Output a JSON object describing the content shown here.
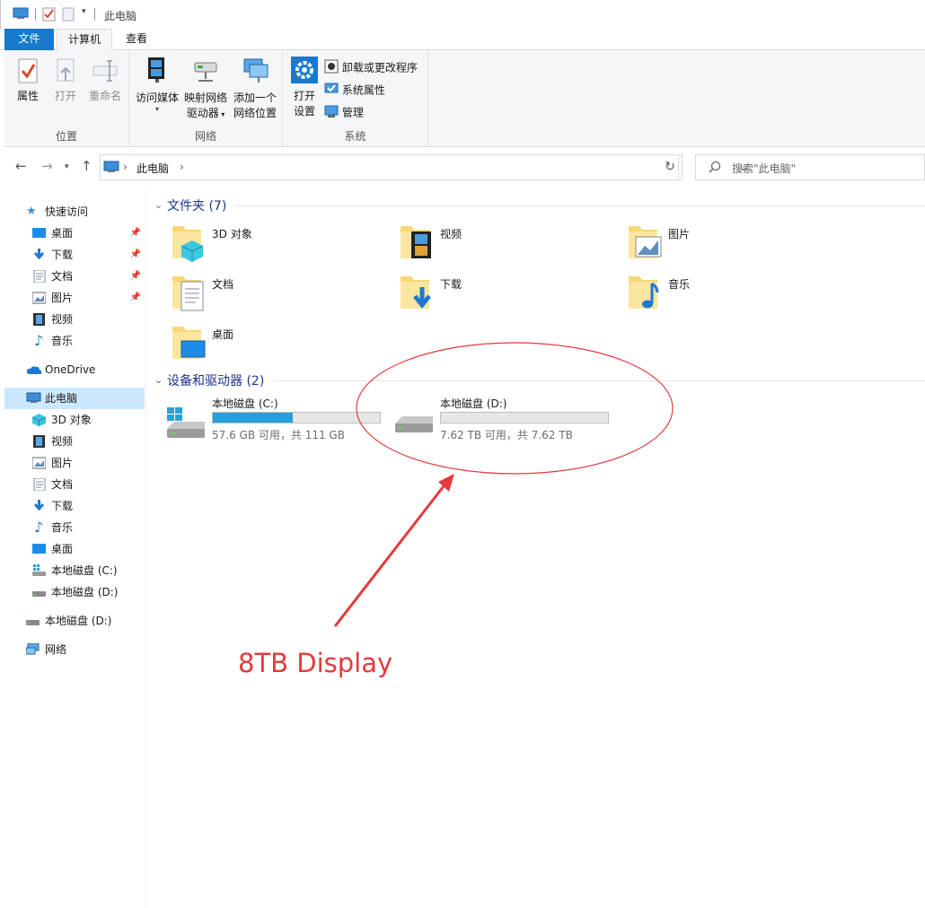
{
  "titlebar": {
    "title": "此电脑"
  },
  "tabs": {
    "file": "文件",
    "computer": "计算机",
    "view": "查看"
  },
  "ribbon": {
    "location": {
      "label": "位置",
      "properties": "属性",
      "open": "打开",
      "rename": "重命名"
    },
    "network": {
      "label": "网络",
      "media_line1": "访问媒体",
      "map_line1": "映射网络",
      "map_line2": "驱动器",
      "add_line1": "添加一个",
      "add_line2": "网络位置"
    },
    "system": {
      "label": "系统",
      "settings_line1": "打开",
      "settings_line2": "设置",
      "uninstall": "卸载或更改程序",
      "sysprops": "系统属性",
      "manage": "管理"
    }
  },
  "address": {
    "path": "此电脑",
    "search_placeholder": "搜索\"此电脑\""
  },
  "nav": {
    "quick_access": "快速访问",
    "quick": [
      "桌面",
      "下载",
      "文档",
      "图片",
      "视频",
      "音乐"
    ],
    "onedrive": "OneDrive",
    "this_pc": "此电脑",
    "pc": [
      "3D 对象",
      "视频",
      "图片",
      "文档",
      "下载",
      "音乐",
      "桌面",
      "本地磁盘 (C:)",
      "本地磁盘 (D:)"
    ],
    "disk_d": "本地磁盘 (D:)",
    "network": "网络"
  },
  "content": {
    "folders_header": "文件夹 (7)",
    "folders": [
      "3D 对象",
      "视频",
      "图片",
      "文档",
      "下载",
      "音乐",
      "桌面"
    ],
    "drives_header": "设备和驱动器 (2)",
    "drives": [
      {
        "name": "本地磁盘 (C:)",
        "free": "57.6 GB 可用，共 111 GB",
        "used_fraction": 0.48
      },
      {
        "name": "本地磁盘 (D:)",
        "free": "7.62 TB 可用，共 7.62 TB",
        "used_fraction": 0.0
      }
    ]
  },
  "annotation": {
    "text": "8TB Display",
    "color": "#e5393c"
  },
  "colors": {
    "accent": "#1979ca",
    "selection": "#cce8ff",
    "bar_fill": "#26a0da"
  }
}
